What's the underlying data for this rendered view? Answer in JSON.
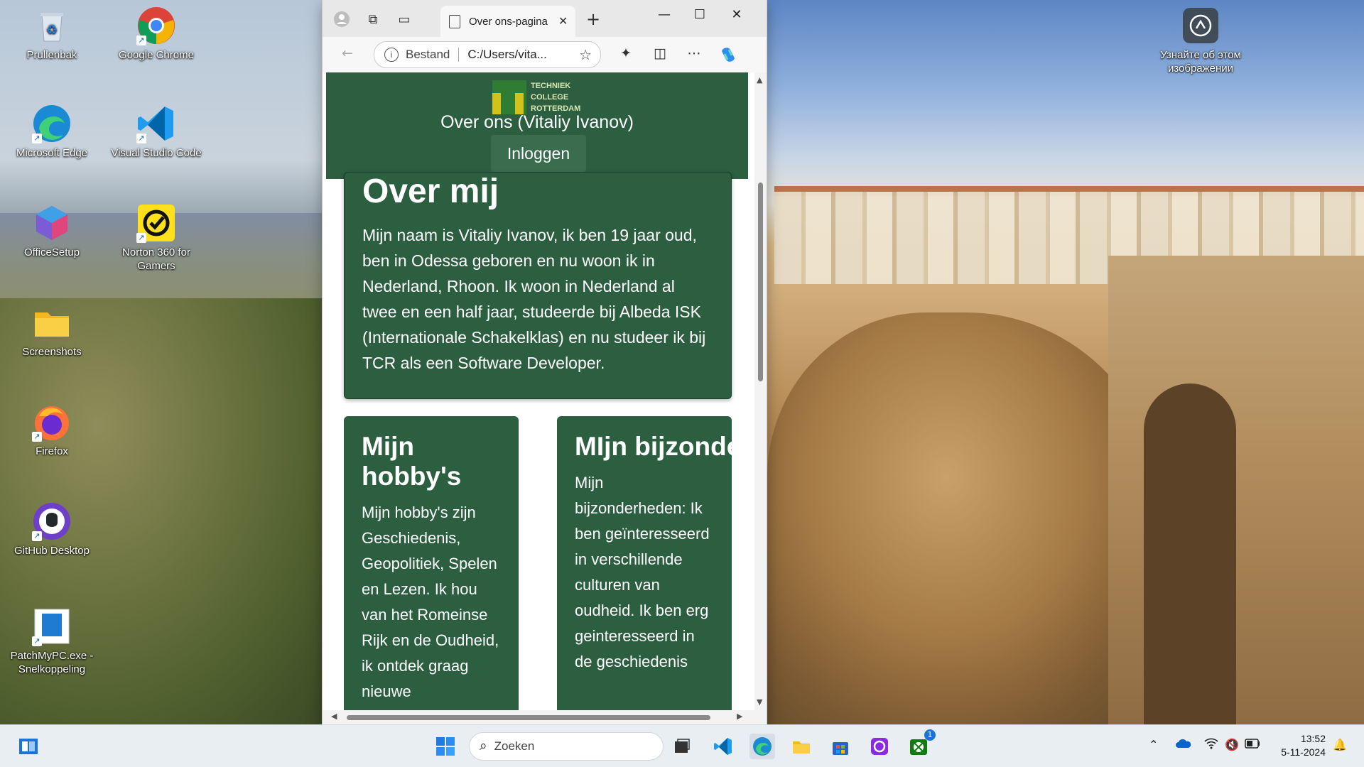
{
  "desktop": {
    "icons_left": [
      {
        "label": "Prullenbak",
        "icon": "recycle-bin-icon"
      },
      {
        "label": "Microsoft Edge",
        "icon": "edge-icon"
      },
      {
        "label": "OfficeSetup",
        "icon": "office-icon"
      },
      {
        "label": "Screenshots",
        "icon": "folder-icon"
      },
      {
        "label": "Firefox",
        "icon": "firefox-icon"
      },
      {
        "label": "GitHub Desktop",
        "icon": "github-icon"
      },
      {
        "label": "PatchMyPC.exe - Snelkoppeling",
        "icon": "patchmypc-icon"
      }
    ],
    "icons_right": [
      {
        "label": "Google Chrome",
        "icon": "chrome-icon"
      },
      {
        "label": "Visual Studio Code",
        "icon": "vscode-icon"
      },
      {
        "label": "Norton 360 for Gamers",
        "icon": "norton-icon"
      }
    ],
    "spotlight": {
      "label": "Узнайте об этом изображении",
      "icon": "camera-icon"
    }
  },
  "browser": {
    "tab_title": "Over ons-pagina",
    "address_label": "Bestand",
    "address_url": "C:/Users/vita...",
    "colors": {
      "header_green": "#2c5e40",
      "card_green": "#2c5e40"
    }
  },
  "page": {
    "logo_lines": [
      "TECHNIEK",
      "COLLEGE",
      "ROTTERDAM"
    ],
    "title": "Over ons (Vitaliy Ivanov)",
    "login": "Inloggen",
    "about": {
      "heading": "Over mij",
      "text": "Mijn naam is Vitaliy Ivanov, ik ben 19 jaar oud, ben in Odessa geboren en nu woon ik in Nederland, Rhoon. Ik woon in Nederland al twee en een half jaar, studeerde bij Albeda ISK (Internationale Schakelklas) en nu studeer ik bij TCR als een Software Developer."
    },
    "hobby": {
      "heading": "Mijn hobby's",
      "text": "Mijn hobby's zijn Geschiedenis, Geopolitiek, Spelen en Lezen. Ik hou van het Romeinse Rijk en de Oudheid, ik ontdek graag nieuwe"
    },
    "bijzonder": {
      "heading": "MIjn bijzonderheden",
      "text": "Mijn bijzonderheden: Ik ben geïnteresseerd in verschillende culturen van oudheid. Ik ben erg geinteresseerd in de geschiedenis"
    }
  },
  "taskbar": {
    "search_placeholder": "Zoeken",
    "time": "13:52",
    "date": "5-11-2024",
    "badge_count": "1"
  }
}
